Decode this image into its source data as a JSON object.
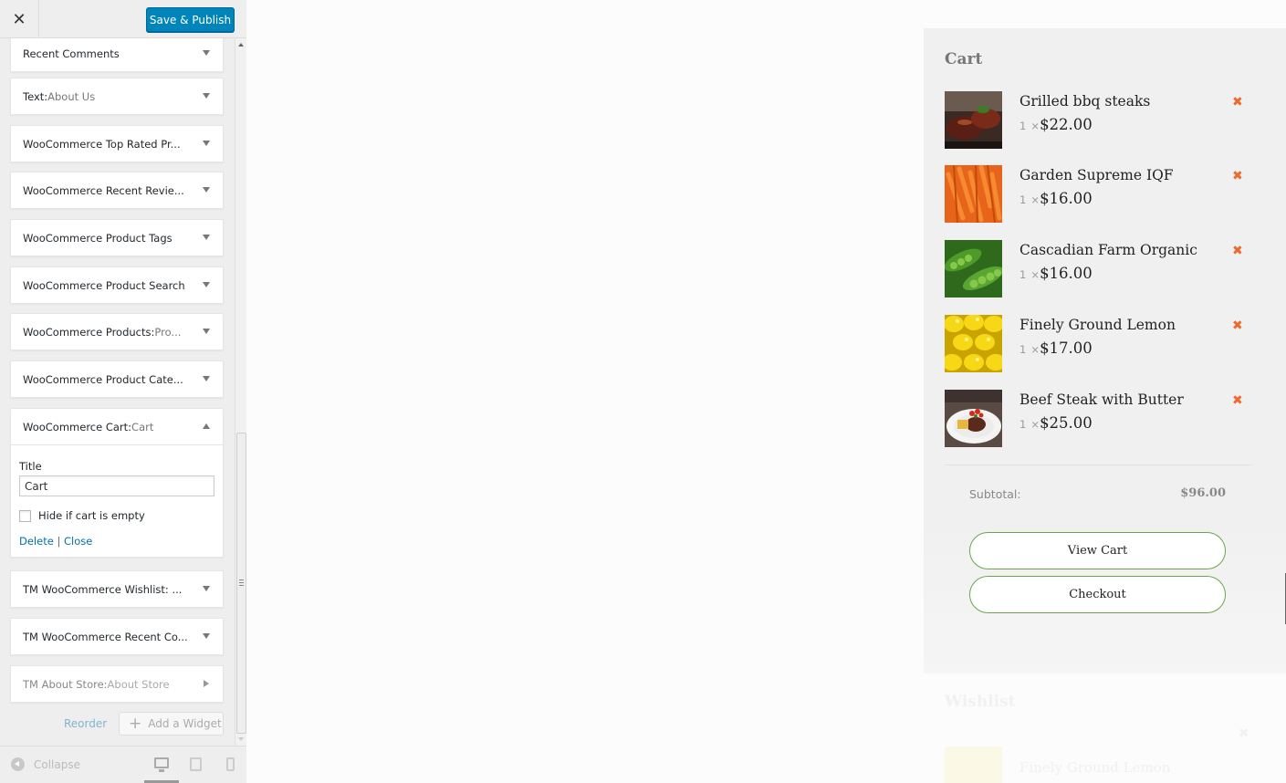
{
  "header": {
    "close_icon": "close-icon",
    "publish_label": "Save & Publish",
    "accent_color": "#0085ba"
  },
  "widgets": [
    {
      "title": "Recent Comments",
      "subtitle": ""
    },
    {
      "title": "Text:",
      "subtitle": " About Us"
    },
    {
      "title": "WooCommerce Top Rated Pr...",
      "subtitle": ""
    },
    {
      "title": "WooCommerce Recent Revie...",
      "subtitle": ""
    },
    {
      "title": "WooCommerce Product Tags",
      "subtitle": ""
    },
    {
      "title": "WooCommerce Product Search",
      "subtitle": ""
    },
    {
      "title": "WooCommerce Products:",
      "subtitle": " Pro..."
    },
    {
      "title": "WooCommerce Product Cate...",
      "subtitle": ""
    },
    {
      "title": "WooCommerce Cart:",
      "subtitle": " Cart"
    },
    {
      "title": "TM WooCommerce Wishlist: ...",
      "subtitle": ""
    },
    {
      "title": "TM WooCommerce Recent Co...",
      "subtitle": ""
    },
    {
      "title": "TM About Store:",
      "subtitle": " About Store"
    }
  ],
  "cart_widget_form": {
    "title_label": "Title",
    "title_value": "Cart",
    "hide_empty_label": "Hide if cart is empty",
    "hide_empty_checked": false,
    "delete_label": "Delete",
    "separator": "|",
    "close_label": "Close"
  },
  "sidebar_footer": {
    "reorder_label": "Reorder",
    "add_widget_label": "Add a Widget",
    "add_icon": "+",
    "collapse_label": "Collapse",
    "devices": [
      "desktop-icon",
      "tablet-icon",
      "mobile-icon"
    ]
  },
  "cart": {
    "title": "Cart",
    "items": [
      {
        "name": "Grilled bbq steaks",
        "qty": "1",
        "times": "×",
        "price": "$22.00"
      },
      {
        "name": "Garden Supreme IQF",
        "qty": "1",
        "times": "×",
        "price": "$16.00"
      },
      {
        "name": "Cascadian Farm Organic",
        "qty": "1",
        "times": "×",
        "price": "$16.00"
      },
      {
        "name": "Finely Ground Lemon",
        "qty": "1",
        "times": "×",
        "price": "$17.00"
      },
      {
        "name": "Beef Steak with Butter",
        "qty": "1",
        "times": "×",
        "price": "$25.00"
      }
    ],
    "remove_symbol": "✖",
    "subtotal_label": "Subtotal:",
    "subtotal_value": "$96.00",
    "view_cart_label": "View Cart",
    "checkout_label": "Checkout",
    "button_border_color": "#6aa649",
    "remove_color": "#ee6a2c"
  },
  "wishlist": {
    "title": "Wishlist",
    "item_name": "Finely Ground Lemon",
    "remove_symbol": "✖"
  }
}
